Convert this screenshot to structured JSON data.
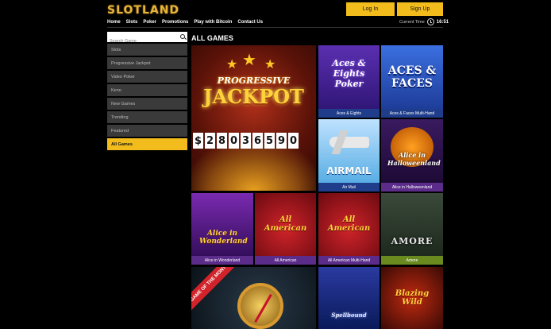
{
  "header": {
    "logo": "SLOTLAND",
    "login_label": "Log In",
    "signup_label": "Sign Up",
    "time_label": "Current Time",
    "time_value": "16:51"
  },
  "nav": [
    "Home",
    "Slots",
    "Poker",
    "Promotions",
    "Play with Bitcoin",
    "Contact Us"
  ],
  "sidebar": {
    "search_placeholder": "Search Game",
    "categories": [
      "Slots",
      "Progressive Jackpot",
      "Video Poker",
      "Keno",
      "New Games",
      "Trending",
      "Featured",
      "All Games"
    ],
    "active": "All Games"
  },
  "main": {
    "title": "ALL GAMES",
    "jackpot": {
      "line1": "PROGRESSIVE",
      "line2": "JACKPOT",
      "digits": [
        "$",
        "2",
        "8",
        "0",
        "3",
        "6",
        "5",
        "9",
        "0"
      ]
    },
    "games": [
      {
        "name": "Aces & Eights",
        "art": "Aces & Eights Poker"
      },
      {
        "name": "Aces & Faces Multi-Hand",
        "art": "ACES & FACES"
      },
      {
        "name": "Air Mail",
        "art": "AIRMAIL"
      },
      {
        "name": "Alice in Halloweenland",
        "art": "Alice in Halloweenland"
      },
      {
        "name": "Alice in Wonderland",
        "art": "Alice in Wonderland"
      },
      {
        "name": "All American",
        "art": "All American"
      },
      {
        "name": "All American Multi-Hand",
        "art": "All American"
      },
      {
        "name": "Amore",
        "art": "AMORE"
      }
    ],
    "game_of_month": "GAME OF THE MONTH",
    "owl_art": "Spellbound",
    "blazing_art": "Blazing Wild"
  },
  "colors": {
    "accent": "#f2bd1c",
    "caption_green": "#6a8a20",
    "caption_blue": "#1f3d8a",
    "sidebar": "#3a3a3a"
  }
}
